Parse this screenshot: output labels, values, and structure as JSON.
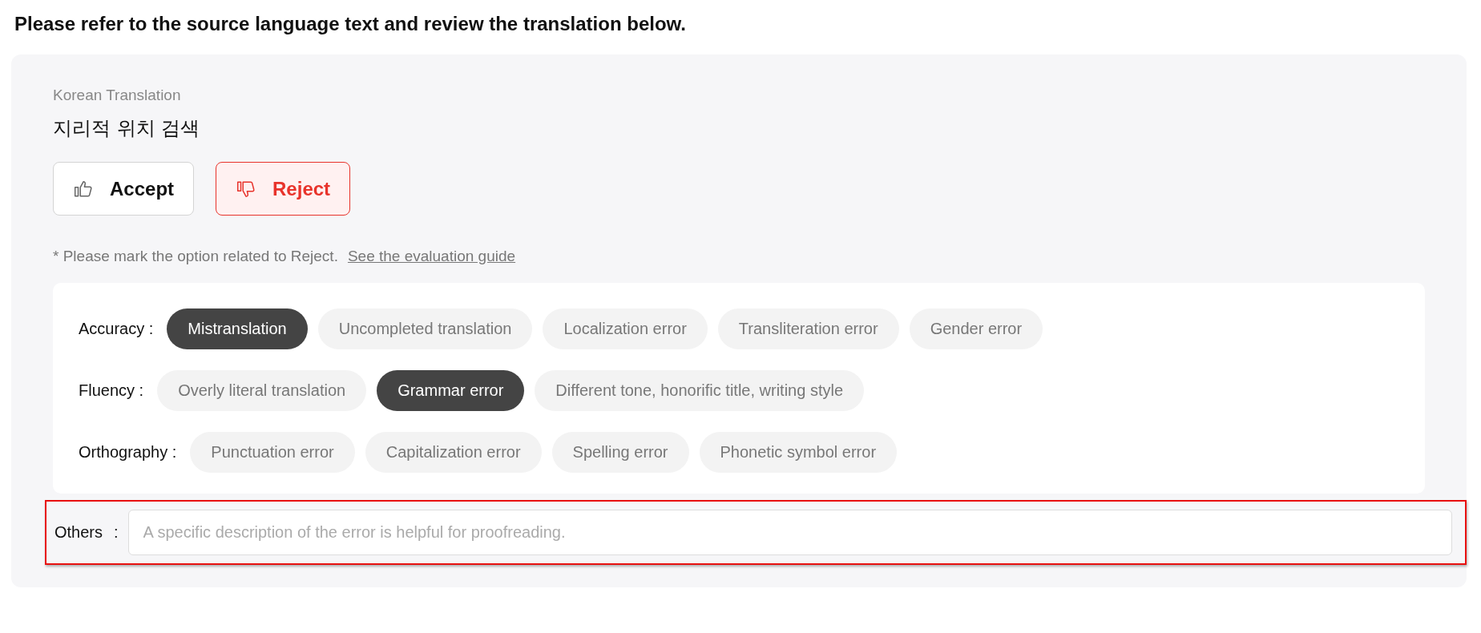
{
  "heading": "Please refer to the source language text and review the translation below.",
  "translation": {
    "label": "Korean Translation",
    "text": "지리적 위치 검색"
  },
  "decision_buttons": [
    {
      "kind": "accept",
      "label": "Accept",
      "selected": false
    },
    {
      "kind": "reject",
      "label": "Reject",
      "selected": true
    }
  ],
  "note": {
    "text": "* Please mark the option related to Reject.",
    "link": "See the evaluation guide"
  },
  "categories": [
    {
      "label": "Accuracy :",
      "options": [
        {
          "label": "Mistranslation",
          "selected": true
        },
        {
          "label": "Uncompleted translation",
          "selected": false
        },
        {
          "label": "Localization error",
          "selected": false
        },
        {
          "label": "Transliteration error",
          "selected": false
        },
        {
          "label": "Gender error",
          "selected": false
        }
      ]
    },
    {
      "label": "Fluency :",
      "options": [
        {
          "label": "Overly literal translation",
          "selected": false
        },
        {
          "label": "Grammar error",
          "selected": true
        },
        {
          "label": "Different tone, honorific title, writing style",
          "selected": false
        }
      ]
    },
    {
      "label": "Orthography :",
      "options": [
        {
          "label": "Punctuation error",
          "selected": false
        },
        {
          "label": "Capitalization error",
          "selected": false
        },
        {
          "label": "Spelling error",
          "selected": false
        },
        {
          "label": "Phonetic symbol error",
          "selected": false
        }
      ]
    }
  ],
  "others": {
    "label": "Others",
    "separator": ":",
    "placeholder": "A specific description of the error is helpful for proofreading.",
    "highlighted": true
  }
}
